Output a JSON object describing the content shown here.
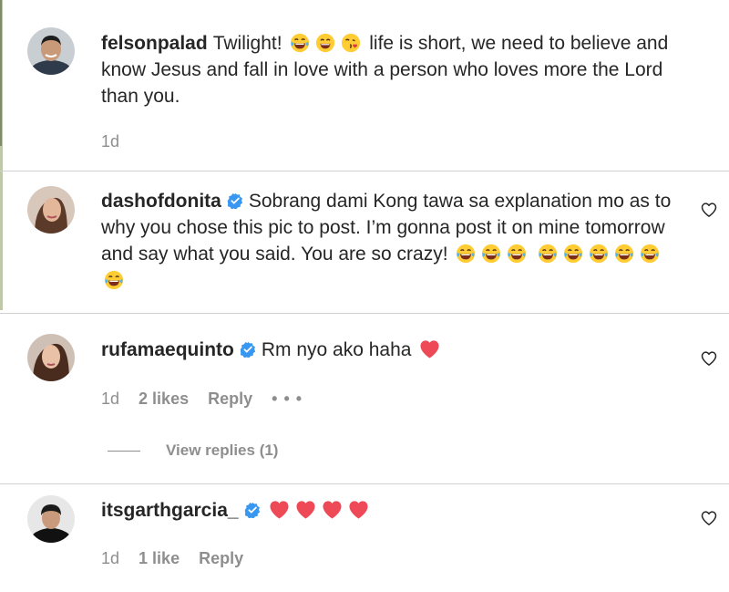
{
  "comments": [
    {
      "username": "felsonpalad",
      "verified": false,
      "text_before": "Twilight!",
      "text_after": "life is short, we need to believe and know Jesus and fall in love with a person who loves more the Lord than you.",
      "time": "1d"
    },
    {
      "username": "dashofdonita",
      "verified": true,
      "text": "Sobrang dami Kong tawa sa explanation mo as to why you chose this pic to post. I’m gonna post it on mine tomorrow and say what you said. You are so crazy!"
    },
    {
      "username": "rufamaequinto",
      "verified": true,
      "text": "Rm nyo ako haha",
      "time": "1d",
      "likes": "2 likes",
      "reply": "Reply",
      "more": "• • •",
      "view_replies": "View replies (1)"
    },
    {
      "username": "itsgarthgarcia_",
      "verified": true,
      "time": "1d",
      "likes": "1 like",
      "reply": "Reply"
    }
  ],
  "icons": {
    "like": "heart-outline-icon",
    "verified": "verified-badge-icon",
    "emoji_laugh": "tears-of-joy-emoji",
    "emoji_smile": "grinning-emoji",
    "emoji_kiss": "face-blowing-kiss-emoji",
    "heart": "red-heart-emoji"
  },
  "colors": {
    "verified": "#3897f0",
    "heart": "#ed4956",
    "meta": "#8e8e8e",
    "text": "#262626"
  }
}
